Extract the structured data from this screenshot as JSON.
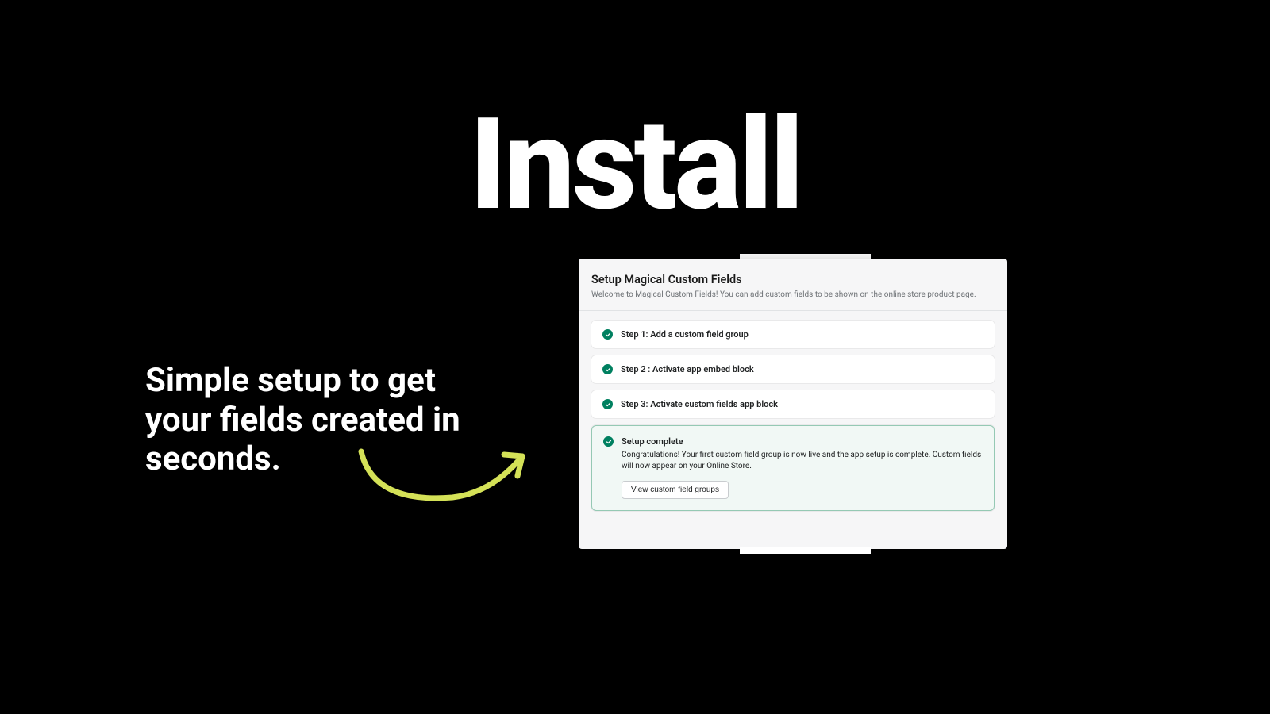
{
  "hero": {
    "title": "Install",
    "tagline": "Simple setup to get your fields created in seconds."
  },
  "panel": {
    "title": "Setup Magical Custom Fields",
    "subtitle": "Welcome to Magical Custom Fields! You can add custom fields to be shown on the online store product page.",
    "steps": [
      {
        "label": "Step 1: Add a custom field group"
      },
      {
        "label": "Step 2 : Activate app embed block"
      },
      {
        "label": "Step 3: Activate custom fields app block"
      }
    ],
    "complete": {
      "title": "Setup complete",
      "body": "Congratulations! Your first custom field group is now live and the app setup is complete. Custom fields will now appear on your Online Store.",
      "button": "View custom field groups"
    }
  },
  "colors": {
    "accent_green": "#008060",
    "arrow": "#d4e157"
  }
}
